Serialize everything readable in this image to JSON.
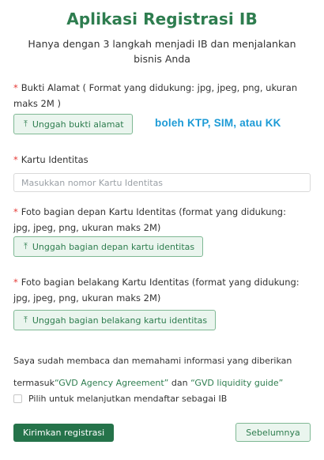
{
  "header": {
    "title": "Aplikasi Registrasi IB",
    "subtitle": "Hanya dengan 3 langkah menjadi IB dan menjalankan bisnis Anda"
  },
  "address_proof": {
    "required_mark": "*",
    "label": "Bukti Alamat ( Format yang didukung: jpg, jpeg, png, ukuran maks 2M )",
    "button_label": "Unggah bukti alamat",
    "note": "boleh KTP, SIM, atau KK"
  },
  "id_card": {
    "required_mark": "*",
    "label": "Kartu Identitas",
    "placeholder": "Masukkan nomor Kartu Identitas",
    "value": ""
  },
  "id_front": {
    "required_mark": "*",
    "label": "Foto bagian depan Kartu Identitas (format yang didukung: jpg, jpeg, png, ukuran maks 2M)",
    "button_label": "Unggah bagian depan kartu identitas"
  },
  "id_back": {
    "required_mark": "*",
    "label": "Foto bagian belakang Kartu Identitas (format yang didukung: jpg, jpeg, png, ukuran maks 2M)",
    "button_label": "Unggah bagian belakang kartu identitas"
  },
  "agreement": {
    "text_before": "Saya sudah membaca dan memahami informasi yang diberikan termasuk",
    "link1": "“GVD Agency Agreement”",
    "text_middle": " dan ",
    "link2": "“GVD liquidity guide”",
    "checkbox_label": "Pilih untuk melanjutkan mendaftar sebagai IB",
    "checked": false
  },
  "actions": {
    "submit_label": "Kirimkan registrasi",
    "previous_label": "Sebelumnya"
  },
  "icons": {
    "upload": "upload-icon"
  },
  "colors": {
    "primary": "#2e7d4f",
    "required": "#e53935",
    "note": "#1d9bd6"
  }
}
